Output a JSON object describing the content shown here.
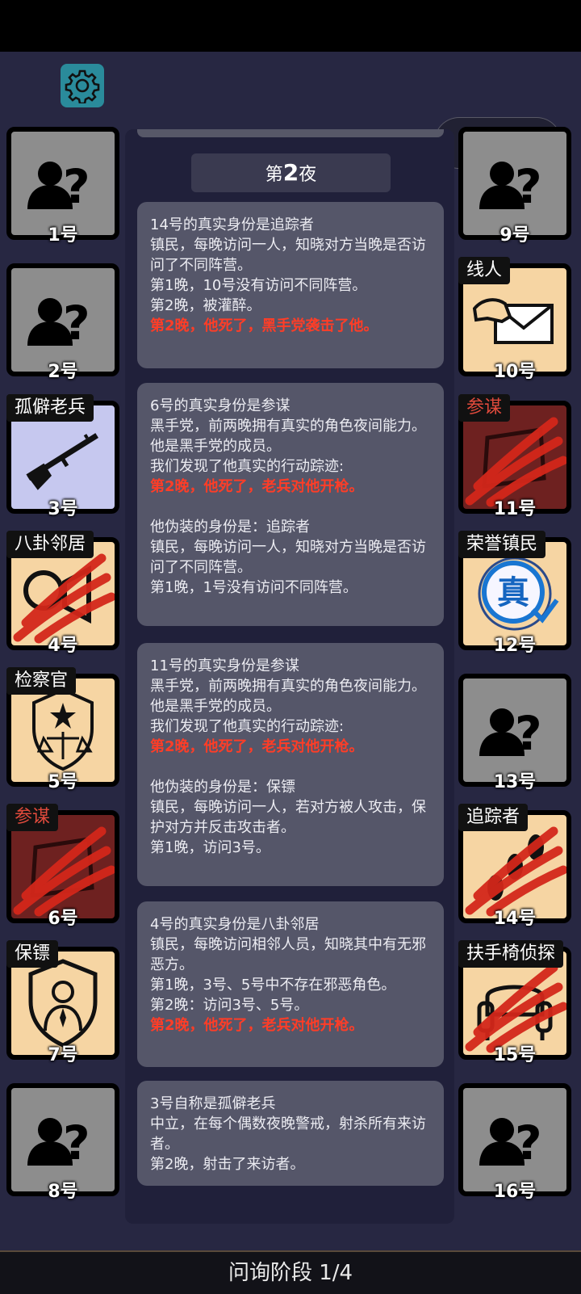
{
  "night": {
    "prefix": "第",
    "number": "2",
    "suffix": "夜"
  },
  "capsule": {
    "more": "•••"
  },
  "players": [
    {
      "num": "1号",
      "role": "",
      "state": "unknown"
    },
    {
      "num": "2号",
      "role": "",
      "state": "unknown"
    },
    {
      "num": "3号",
      "role": "孤僻老兵",
      "state": "revealed",
      "icon": "rifle-icon"
    },
    {
      "num": "4号",
      "role": "八卦邻居",
      "state": "dead",
      "icon": "neighbor-icon"
    },
    {
      "num": "5号",
      "role": "检察官",
      "state": "revealed",
      "icon": "prosecutor-badge-icon"
    },
    {
      "num": "6号",
      "role": "参谋",
      "state": "dead",
      "icon": "strategist-icon"
    },
    {
      "num": "7号",
      "role": "保镖",
      "state": "revealed",
      "icon": "bodyguard-shield-icon"
    },
    {
      "num": "8号",
      "role": "",
      "state": "unknown"
    },
    {
      "num": "9号",
      "role": "",
      "state": "unknown"
    },
    {
      "num": "10号",
      "role": "线人",
      "state": "revealed",
      "icon": "informant-envelope-icon"
    },
    {
      "num": "11号",
      "role": "参谋",
      "state": "dead",
      "icon": "strategist-icon"
    },
    {
      "num": "12号",
      "role": "荣誉镇民",
      "state": "revealed",
      "icon": "honor-seal-icon",
      "seal_text": "真"
    },
    {
      "num": "13号",
      "role": "",
      "state": "unknown"
    },
    {
      "num": "14号",
      "role": "追踪者",
      "state": "dead",
      "icon": "tracker-footprints-icon"
    },
    {
      "num": "15号",
      "role": "扶手椅侦探",
      "state": "dead",
      "icon": "armchair-icon"
    },
    {
      "num": "16号",
      "role": "",
      "state": "unknown"
    }
  ],
  "cards": [
    {
      "lines": [
        {
          "text": "14号的真实身份是追踪者",
          "red": false
        },
        {
          "text": "镇民，每晚访问一人，知晓对方当晚是否访问了不同阵营。",
          "red": false
        },
        {
          "text": "第1晚，10号没有访问不同阵营。",
          "red": false
        },
        {
          "text": "第2晚，被灌醉。",
          "red": false
        },
        {
          "text": "第2晚，他死了，黑手党袭击了他。",
          "red": true
        }
      ]
    },
    {
      "lines": [
        {
          "text": "6号的真实身份是参谋",
          "red": false
        },
        {
          "text": "黑手党，前两晚拥有真实的角色夜间能力。",
          "red": false
        },
        {
          "text": "他是黑手党的成员。",
          "red": false
        },
        {
          "text": "我们发现了他真实的行动踪迹:",
          "red": false
        },
        {
          "text": "第2晚，他死了，老兵对他开枪。",
          "red": true
        },
        {
          "text": "",
          "red": false
        },
        {
          "text": "他伪装的身份是：追踪者",
          "red": false
        },
        {
          "text": "镇民，每晚访问一人，知晓对方当晚是否访问了不同阵营。",
          "red": false
        },
        {
          "text": "第1晚，1号没有访问不同阵营。",
          "red": false
        }
      ]
    },
    {
      "lines": [
        {
          "text": "11号的真实身份是参谋",
          "red": false
        },
        {
          "text": "黑手党，前两晚拥有真实的角色夜间能力。",
          "red": false
        },
        {
          "text": "他是黑手党的成员。",
          "red": false
        },
        {
          "text": "我们发现了他真实的行动踪迹:",
          "red": false
        },
        {
          "text": "第2晚，他死了，老兵对他开枪。",
          "red": true
        },
        {
          "text": "",
          "red": false
        },
        {
          "text": "他伪装的身份是：保镖",
          "red": false
        },
        {
          "text": "镇民，每晚访问一人，若对方被人攻击，保护对方并反击攻击者。",
          "red": false
        },
        {
          "text": "第1晚，访问3号。",
          "red": false
        }
      ]
    },
    {
      "lines": [
        {
          "text": "4号的真实身份是八卦邻居",
          "red": false
        },
        {
          "text": "镇民，每晚访问相邻人员，知晓其中有无邪恶方。",
          "red": false
        },
        {
          "text": "第1晚，3号、5号中不存在邪恶角色。",
          "red": false
        },
        {
          "text": "第2晚：访问3号、5号。",
          "red": false
        },
        {
          "text": "第2晚，他死了，老兵对他开枪。",
          "red": true
        }
      ]
    },
    {
      "lines": [
        {
          "text": "3号自称是孤僻老兵",
          "red": false
        },
        {
          "text": "中立，在每个偶数夜晚警戒，射杀所有来访者。",
          "red": false
        },
        {
          "text": "第2晚，射击了来访者。",
          "red": false
        }
      ]
    }
  ],
  "phase": {
    "label": "问询阶段 1/4"
  },
  "colors": {
    "revealed_bg": "#f6d5a3",
    "dead_bg": "#6e2120",
    "unknown_bg": "#8d8d8d",
    "death_text": "#ff3d27",
    "settings_bg": "#2a8b9b"
  }
}
